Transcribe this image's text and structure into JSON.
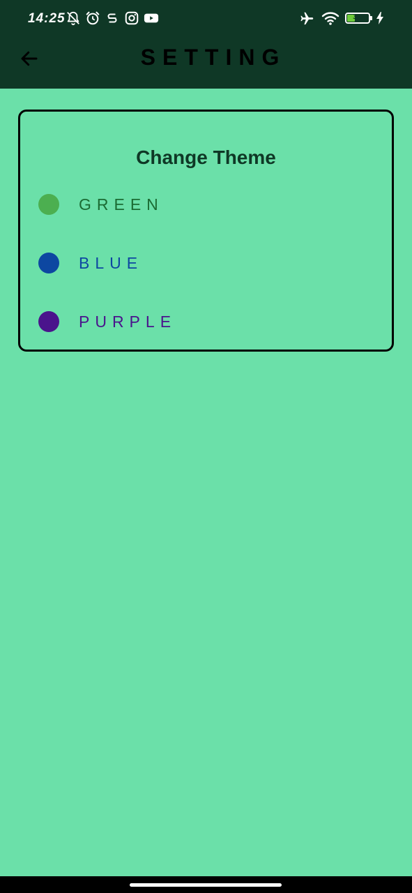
{
  "status_bar": {
    "time": "14:25",
    "left_icons": [
      "bell-off-icon",
      "alarm-icon",
      "s-app-icon",
      "instagram-icon",
      "youtube-icon"
    ],
    "right_icons": [
      "airplane-icon",
      "wifi-icon",
      "battery-icon",
      "charging-icon"
    ],
    "battery_level": "33"
  },
  "app_bar": {
    "title": "SETTING",
    "back_icon": "arrow-left-icon"
  },
  "theme_card": {
    "title": "Change Theme",
    "options": [
      {
        "label": "GREEN",
        "color": "#4caf50",
        "text_color": "#1b6b33"
      },
      {
        "label": "BLUE",
        "color": "#0d47a1",
        "text_color": "#0d47a1"
      },
      {
        "label": "PURPLE",
        "color": "#4a148c",
        "text_color": "#4a148c"
      }
    ]
  },
  "colors": {
    "background": "#6be0a9",
    "app_bar": "#0f3826"
  }
}
